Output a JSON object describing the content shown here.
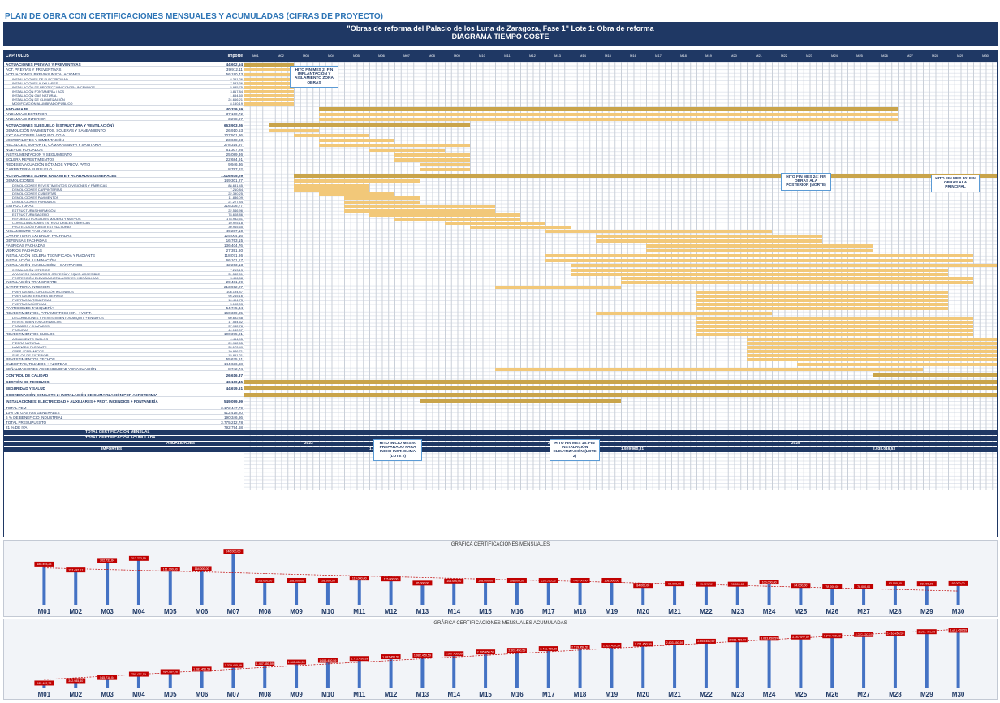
{
  "page": {
    "title": "PLAN DE OBRA CON CERTIFICACIONES MENSUALES Y ACUMULADAS (CIFRAS DE PROYECTO)",
    "banner_line1": "\"Obras de reforma del Palacio de los Luna de Zaragoza, Fase 1\"   Lote 1: Obra de reforma",
    "banner_line2": "DIAGRAMA TIEMPO COSTE"
  },
  "table": {
    "header_label": "CAPÍTULOS",
    "header_importe": "Importe",
    "rows": [
      {
        "label": "ACTUACIONES PREVIAS Y PREVENTIVAS",
        "value": "44.602,54",
        "group": true
      },
      {
        "label": "ACT. PREVIAS Y PREVENTIVAS",
        "value": "39.912,11"
      },
      {
        "label": "ACTUACIONES PREVIAS INSTALACIONES",
        "value": "56.190,43"
      },
      {
        "label": "INSTALACIONES DE ELECTRICIDAD",
        "value": "8.351,26",
        "sub": true
      },
      {
        "label": "INSTALACIONES AUXILIARES",
        "value": "7.533,36",
        "sub": true
      },
      {
        "label": "INSTALACIÓN DE PROTECCIÓN CONTRA INCENDIOS",
        "value": "5.935,75",
        "sub": true
      },
      {
        "label": "INSTALACIÓN FONTANERÍA / ACS",
        "value": "3.817,84",
        "sub": true
      },
      {
        "label": "INSTALACIÓN GAS NATURAL",
        "value": "1.654,60",
        "sub": true
      },
      {
        "label": "INSTALACIÓN DE CLIMATIZACIÓN",
        "value": "24.666,21",
        "sub": true
      },
      {
        "label": "MODIFICACIÓN ALUMBRADO PÚBLICO",
        "value": "8.150,19",
        "sub": true
      },
      {
        "label": "ANDAMIAJE",
        "value": "40.379,69",
        "group": true
      },
      {
        "label": "ANDAMIAJE EXTERIOR",
        "value": "37.100,72"
      },
      {
        "label": "ANDAMIAJE INTERIOR",
        "value": "3.278,97"
      },
      {
        "label": "ACTUACIONES SUBSUELO (ESTRUCTURA Y VENTILACIÓN)",
        "value": "663.903,26",
        "group": true
      },
      {
        "label": "DEMOLICIÓN PAVIMENTOS, SOLERAS Y SANEAMIENTO",
        "value": "26.910,53"
      },
      {
        "label": "EXCAVACIONES / ARQUEOLOGÍA",
        "value": "107.501,86"
      },
      {
        "label": "MICROPILOTES Y CIMENTACIÓN",
        "value": "23.668,93"
      },
      {
        "label": "RECALCES, SOPORTE, CÁMARAS BUFA Y SANITARIA",
        "value": "278.314,97"
      },
      {
        "label": "NUEVOS FORJADOS",
        "value": "61.307,26"
      },
      {
        "label": "INSTRUMENTACIÓN Y SEGUIMIENTO",
        "value": "25.089,36"
      },
      {
        "label": "SOLERA REVESTIMIENTOS",
        "value": "22.684,91"
      },
      {
        "label": "REDES EVACUACIÓN SÓTANOS Y PROV. PATIO",
        "value": "9.946,36"
      },
      {
        "label": "CARPINTERÍA SUBSUELO",
        "value": "8.797,62"
      },
      {
        "label": "ACTUACIONES SOBRE RASANTE Y ACABADOS GENERALES",
        "value": "1.016.935,29",
        "group": true
      },
      {
        "label": "DEMOLICIONES",
        "value": "149.301,27"
      },
      {
        "label": "DEMOLICIONES REVESTIMIENTOS, DIVISIONES Y FÁBRICAS",
        "value": "88.681,45",
        "sub": true
      },
      {
        "label": "DEMOLICIONES CARPINTERÍAS",
        "value": "7.210,84",
        "sub": true
      },
      {
        "label": "DEMOLICIONES CUBIERTAS",
        "value": "22.390,25",
        "sub": true
      },
      {
        "label": "DEMOLICIONES PAVIMENTOS",
        "value": "11.886,09",
        "sub": true
      },
      {
        "label": "DEMOLICIONES FORJADOS",
        "value": "21.227,44",
        "sub": true
      },
      {
        "label": "ESTRUCTURAS",
        "value": "316.336,77"
      },
      {
        "label": "ESTRUCTURAS HORMIGÓN",
        "value": "22.546,96",
        "sub": true
      },
      {
        "label": "ESTRUCTURAS ACERO",
        "value": "78.608,86",
        "sub": true
      },
      {
        "label": "REFUERZO FORJADOS MADERA Y NUEVOS",
        "value": "178.982,51",
        "sub": true
      },
      {
        "label": "CONSOLIDACIONES ESTRUCTURALES FÁBRICAS",
        "value": "10.925,18",
        "sub": true
      },
      {
        "label": "PROTECCIÓN FUEGO ESTRUCTURAS",
        "value": "30.965,65",
        "sub": true
      },
      {
        "label": "AISLAMIENTO FACHADAS",
        "value": "49.287,10"
      },
      {
        "label": "CARPINTERÍA EXTERIOR FACHADAS",
        "value": "125.004,16"
      },
      {
        "label": "DEFENSAS FACHADAS",
        "value": "16.763,15"
      },
      {
        "label": "FÁBRICAS FACHADAS",
        "value": "136.404,76"
      },
      {
        "label": "VIDRIOS FACHADAS",
        "value": "27.391,80"
      },
      {
        "label": "INSTALACIÓN SOLERA TECNIFICADA Y RADIANTE",
        "value": "118.071,86"
      },
      {
        "label": "INSTALACIÓN ILUMINACIÓN",
        "value": "66.101,17"
      },
      {
        "label": "INSTALACIÓN EVACUACIÓN + SANITARIOS",
        "value": "42.263,13"
      },
      {
        "label": "INSTALACIÓN INTERIOR",
        "value": "7.213,13",
        "sub": true
      },
      {
        "label": "APARATOS SANITARIOS, GRIFERÍA Y EQUIP. ACCESIBLE",
        "value": "31.532,51",
        "sub": true
      },
      {
        "label": "PROTECCIÓN ELEVADA INSTALACIONES HIDRÁULICAS",
        "value": "3.496,58",
        "sub": true
      },
      {
        "label": "INSTALACIÓN TRANSPORTE",
        "value": "29.481,99"
      },
      {
        "label": "CARPINTERÍA INTERIOR",
        "value": "213.962,27"
      },
      {
        "label": "PUERTAS SECTORIZACIÓN INCENDIOS",
        "value": "108.194,47",
        "sub": true
      },
      {
        "label": "PUERTAS INTERIORES DE PASO",
        "value": "95.215,16",
        "sub": true
      },
      {
        "label": "PUERTAS AUTOMÁTICAS",
        "value": "10.494,73",
        "sub": true
      },
      {
        "label": "PUERTAS ACÚSTICAS",
        "value": "5.102,03",
        "sub": true
      },
      {
        "label": "PARTICIONES TABIQUERÍA",
        "value": "54.745,34"
      },
      {
        "label": "REVESTIMIENTOS, PARAMENTOS HOR. + VERT.",
        "value": "160.369,95"
      },
      {
        "label": "DECORACIONES Y REVESTIMIENTOS ARQUIT. + ENSAYOS",
        "value": "60.692,48",
        "sub": true
      },
      {
        "label": "REVESTIMIENTOS CERÁMICOS",
        "value": "17.554,62",
        "sub": true
      },
      {
        "label": "PINTADOS / CHAPADOS",
        "value": "37.982,78",
        "sub": true
      },
      {
        "label": "PINTURAS",
        "value": "44.140,07",
        "sub": true
      },
      {
        "label": "REVESTIMIENTOS SUELOS",
        "value": "100.375,91"
      },
      {
        "label": "AISLAMIENTO SUELOS",
        "value": "4.454,95",
        "sub": true
      },
      {
        "label": "PIEDRA NATURAL",
        "value": "29.952,55",
        "sub": true
      },
      {
        "label": "LAMINADO FLOTANTE",
        "value": "39.170,49",
        "sub": true
      },
      {
        "label": "GRES / CERÁMICOS",
        "value": "10.946,71",
        "sub": true
      },
      {
        "label": "SUELOS DE EXTERIOR",
        "value": "15.851,21",
        "sub": true
      },
      {
        "label": "REVESTIMIENTOS TECHOS",
        "value": "55.675,61"
      },
      {
        "label": "CUBIERTAS, TEJADOS + AZOTEAS",
        "value": "144.636,68"
      },
      {
        "label": "SEÑALIZACIONES ACCESIBILIDAD Y EVACUACIÓN",
        "value": "8.742,74"
      },
      {
        "label": "CONTROL DE CALIDAD",
        "value": "26.616,37",
        "group": true
      },
      {
        "label": "GESTIÓN DE RESIDUOS",
        "value": "46.160,45",
        "group": true
      },
      {
        "label": "SEGURIDAD Y SALUD",
        "value": "44.679,61",
        "group": true
      },
      {
        "label": "COORDINACIÓN CON LOTE 2: INSTALACIÓN DE CLIMATIZACIÓN POR AEROTERMIA",
        "value": "",
        "group": true
      },
      {
        "label": "INSTALACIONES: ELECTRICIDAD + AUXILIARES + PROT. INCENDIOS + FONTANERÍA",
        "value": "549.099,99",
        "group": true
      }
    ],
    "totals": [
      {
        "label": "TOTAL PEM",
        "value": "3.172.447,79"
      },
      {
        "label": "13% DE GASTOS GENERALES",
        "value": "412.418,20"
      },
      {
        "label": "6 % DE BENEFICIO INDUSTRIAL",
        "value": "190.346,86"
      },
      {
        "label": "TOTAL PRESUPUESTO",
        "value": "3.775.212,78"
      },
      {
        "label": "21 % DE IVA",
        "value": "792.794,68"
      }
    ],
    "band_mensual": "TOTAL CERTIFICACIÓN MENSUAL",
    "band_acumulada": "TOTAL CERTIFICACIÓN ACUMULADA",
    "band_anualidades": "ANUALIDADES",
    "band_importes": "IMPORTES",
    "years": [
      "2023",
      "2024",
      "2025"
    ],
    "year_amounts": [
      "1.251.384,33",
      "1.929.960,81",
      "2.038.016,53"
    ]
  },
  "callouts": [
    {
      "text": "HITO FIN MES 2: FIN IMPLANTACIÓN Y AISLAMIENTO ZONA OBRAS"
    },
    {
      "text": "HITO FIN MES 24: FIN OBRAS ALA POSTERIOR (NORTE)"
    },
    {
      "text": "HITO FIN MES 30: FIN OBRAS ALA PRINCIPAL"
    },
    {
      "text": "HITO INICIO MES 9: PREPARADO PARA INICIO INST. CLIMA (LOTE 2)"
    },
    {
      "text": "HITO FIN MES 15: FIN INSTALACIÓN CLIMATIZACIÓN (LOTE 2)"
    }
  ],
  "months": [
    "M01",
    "M02",
    "M03",
    "M04",
    "M05",
    "M06",
    "M07",
    "M08",
    "M09",
    "M10",
    "M11",
    "M12",
    "M13",
    "M14",
    "M15",
    "M16",
    "M17",
    "M18",
    "M19",
    "M20",
    "M21",
    "M22",
    "M23",
    "M24",
    "M25",
    "M26",
    "M27",
    "M28",
    "M29",
    "M30"
  ],
  "colors": {
    "navy": "#1f3864",
    "bar": "#4472c4",
    "label": "#c00000",
    "trend": "#c00000",
    "gantt_group": "#c9a44a",
    "gantt_task": "#f2c879"
  },
  "chart_data": [
    {
      "type": "bar",
      "title": "GRÁFICA CERTIFICACIONES MENSUALES",
      "categories": [
        "M01",
        "M02",
        "M03",
        "M04",
        "M05",
        "M06",
        "M07",
        "M08",
        "M09",
        "M10",
        "M11",
        "M12",
        "M13",
        "M14",
        "M15",
        "M16",
        "M17",
        "M18",
        "M19",
        "M20",
        "M21",
        "M22",
        "M23",
        "M24",
        "M25",
        "M26",
        "M27",
        "M28",
        "M29",
        "M30"
      ],
      "values": [
        185493,
        157492,
        202733,
        212733,
        161000,
        164000,
        246000,
        108000,
        108000,
        108000,
        119000,
        115000,
        95000,
        105000,
        108000,
        108000,
        108000,
        108000,
        108000,
        84000,
        92000,
        90000,
        90000,
        100000,
        84000,
        78000,
        78000,
        93000,
        92000,
        93000
      ],
      "value_labels": [
        "185.493,23",
        "157.492,17",
        "202.732,64",
        "212.732,55",
        "161.000,00",
        "164.000,00",
        "246.000,00",
        "108.000,00",
        "108.000,00",
        "108.000,00",
        "119.000,00",
        "115.000,00",
        "95.000,00",
        "105.000,00",
        "108.000,00",
        "108.000,00",
        "108.000,00",
        "108.000,00",
        "108.000,00",
        "84.000,00",
        "92.000,00",
        "90.000,00",
        "90.000,00",
        "100.000,00",
        "84.000,00",
        "78.000,00",
        "78.000,00",
        "93.000,00",
        "92.000,00",
        "93.000,00"
      ],
      "trendline": true
    },
    {
      "type": "bar",
      "title": "GRÁFICA CERTIFICACIONES MENSUALES ACUMULADAS",
      "categories": [
        "M01",
        "M02",
        "M03",
        "M04",
        "M05",
        "M06",
        "M07",
        "M08",
        "M09",
        "M10",
        "M11",
        "M12",
        "M13",
        "M14",
        "M15",
        "M16",
        "M17",
        "M18",
        "M19",
        "M20",
        "M21",
        "M22",
        "M23",
        "M24",
        "M25",
        "M26",
        "M27",
        "M28",
        "M29",
        "M30"
      ],
      "values": [
        185493,
        342985,
        545718,
        758450,
        919450,
        1083450,
        1329450,
        1437450,
        1545450,
        1653450,
        1772450,
        1887450,
        1982450,
        2087450,
        2195450,
        2303450,
        2411450,
        2519450,
        2627450,
        2711450,
        2803450,
        2893450,
        2983450,
        3083450,
        3167450,
        3245450,
        3323450,
        3416450,
        3508450,
        3601450
      ],
      "value_labels": [
        "185.493,23",
        "342.985,40",
        "545.718,04",
        "758.450,59",
        "919.450,59",
        "1.083.450,59",
        "1.329.450,59",
        "1.437.450,59",
        "1.545.450,59",
        "1.653.450,59",
        "1.772.450,59",
        "1.887.450,59",
        "1.982.450,59",
        "2.087.450,59",
        "2.195.450,59",
        "2.303.450,59",
        "2.411.450,59",
        "2.519.450,59",
        "2.627.450,59",
        "2.711.450,59",
        "2.803.450,59",
        "2.893.450,59",
        "2.983.450,59",
        "3.083.450,59",
        "3.167.450,59",
        "3.245.450,59",
        "3.323.450,59",
        "3.416.450,59",
        "3.508.450,59",
        "3.601.450,59"
      ],
      "trendline": true
    }
  ]
}
